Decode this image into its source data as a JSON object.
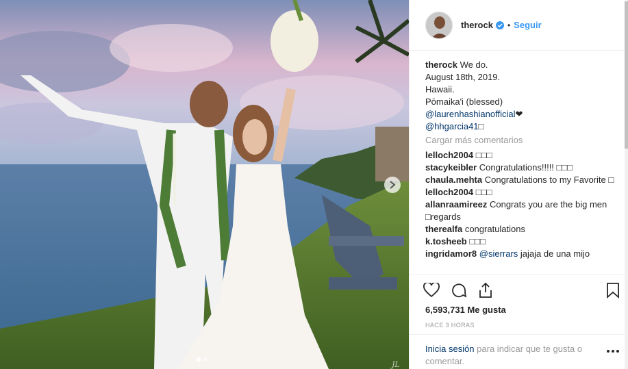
{
  "header": {
    "username": "therock",
    "follow_label": "Seguir",
    "separator": "•"
  },
  "caption": {
    "username": "therock",
    "lines": [
      "We do.",
      "August 18th, 2019.",
      "Hawaii.",
      "Pōmaika'i (blessed)"
    ],
    "mention1": "@laurenhashianofficial",
    "mention1_suffix": "❤",
    "mention2": "@hhgarcia41",
    "mention2_suffix": "□"
  },
  "load_more": "Cargar más comentarios",
  "comments": [
    {
      "user": "lelloch2004",
      "text": "□□□"
    },
    {
      "user": "stacykeibler",
      "text": "Congratulations!!!!! □□□"
    },
    {
      "user": "chaula.mehta",
      "text": "Congratulations to my Favorite □"
    },
    {
      "user": "lelloch2004",
      "text": "□□□"
    },
    {
      "user": "allanraamireez",
      "text": "Congrats you are the big men □regards"
    },
    {
      "user": "therealfa",
      "text": "congratulations"
    },
    {
      "user": "k.tosheeb",
      "text": "□□□"
    },
    {
      "user": "ingridamor8",
      "text": "jajaja de una mijo",
      "mention": "@sierrars"
    }
  ],
  "likes": "6,593,731 Me gusta",
  "timestamp": "Hace 3 horas",
  "footer": {
    "login_link": "Inicia sesión",
    "login_text": "para indicar que te gusta o comentar."
  },
  "photo": {
    "signature": "JL",
    "slide_count": 2,
    "active_slide": 1
  },
  "colors": {
    "accent": "#3897f0",
    "link": "#003569",
    "muted": "#999999",
    "border": "#efefef"
  },
  "icons": [
    "verified-badge-icon",
    "heart-icon",
    "comment-icon",
    "share-icon",
    "bookmark-icon",
    "chevron-right-icon",
    "more-options-icon"
  ]
}
